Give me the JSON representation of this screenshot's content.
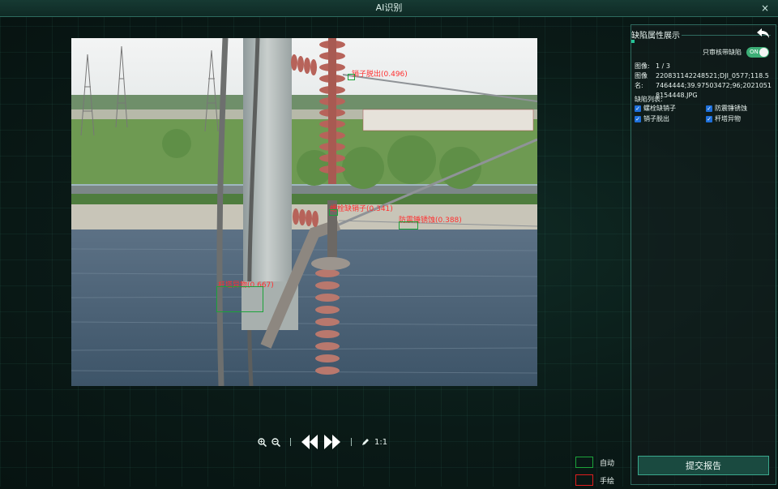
{
  "window": {
    "title": "AI识别",
    "close_glyph": "×"
  },
  "detections": [
    {
      "label": "销子脱出(0.496)",
      "type": "auto"
    },
    {
      "label": "螺栓缺销子(0.341)",
      "type": "auto"
    },
    {
      "label": "防震锤锈蚀(0.388)",
      "type": "auto"
    },
    {
      "label": "杆塔异物(0.667)",
      "type": "auto"
    }
  ],
  "toolbar": {
    "zoom_in": "zoom-in-icon",
    "zoom_out": "zoom-out-icon",
    "prev": "prev-icon",
    "next": "next-icon",
    "edit": "pencil-icon",
    "ratio": "1:1"
  },
  "legend": [
    {
      "label": "自动",
      "color": "#1ca33a"
    },
    {
      "label": "手绘",
      "color": "#e01e1e"
    }
  ],
  "panel": {
    "title": "缺陷属性展示",
    "toggle_label": "只审核带缺陷",
    "toggle_state": "ON",
    "image_label": "图像:",
    "image_value": "1 / 3",
    "name_label": "图像名:",
    "name_value": "220831142248521;DJI_0577;118.57464444;39.97503472;96;20210518154448.JPG",
    "list_title": "缺陷列表:",
    "checks": [
      "螺栓缺销子",
      "防震锤锈蚀",
      "销子脱出",
      "杆塔异物"
    ],
    "submit": "提交报告"
  },
  "colors": {
    "accent": "#3cae76",
    "border": "#2f6a5f",
    "auto": "#1ca33a",
    "manual": "#e01e1e"
  }
}
